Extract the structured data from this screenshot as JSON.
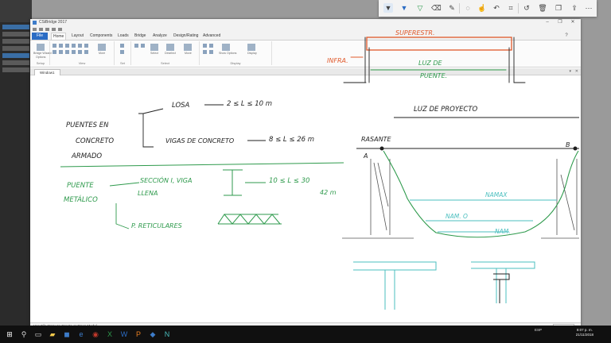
{
  "app": {
    "title": "CSiBridge 2017",
    "window_controls": {
      "minimize": "–",
      "maximize": "❐",
      "close": "✕"
    }
  },
  "ribbon": {
    "file_tab": "File",
    "tabs": [
      "Home",
      "Layout",
      "Components",
      "Loads",
      "Bridge",
      "Analyze",
      "Design/Rating",
      "Advanced"
    ],
    "active_tab": "Home",
    "groups": [
      "Setup",
      "View",
      "Select",
      "Display"
    ],
    "buttons": {
      "bridge_wizard": "Bridge Wizard",
      "options": "Options",
      "set": "Set",
      "select": "Select",
      "deselect": "Deselect",
      "move": "Move",
      "more": "More",
      "show_options": "Show Options",
      "display": "Display"
    }
  },
  "document": {
    "tab_label": "Window1",
    "controls": {
      "pin": "▾",
      "close": "✕"
    }
  },
  "statusbar": {
    "text": "Use File Menu to Create or Open Model",
    "units": "Kgf, m, C"
  },
  "sketch": {
    "top_labels": {
      "superstructure": "SUPERESTR.",
      "infra": "INFRA.",
      "span_line1": "LUZ DE",
      "span_line2": "PUENTE."
    },
    "project_span": "LUZ DE PROYECTO",
    "concrete_title": [
      "PUENTES EN",
      "CONCRETO",
      "ARMADO"
    ],
    "slab_label": "LOSA",
    "slab_range": "2 ≤ L ≤ 10 m",
    "beam_label": "VIGAS DE CONCRETO",
    "beam_range": "8 ≤ L ≤ 26 m",
    "metal_title": [
      "PUENTE",
      "METÁLICO"
    ],
    "section_label": [
      "SECCIÓN I, VIGA",
      "LLENA"
    ],
    "section_range": "10 ≤ L ≤ 30",
    "section_extra": "42 m",
    "truss_label": "P. RETICULARES",
    "abutment_left": "A",
    "abutment_right": "B",
    "deck_label": "RASANTE",
    "water_max": "NAMAX",
    "water_ord": "NAM. O",
    "water_min": "NAM."
  },
  "ink_toolbar": {
    "tools": [
      "ballpoint-pen",
      "pen-blue",
      "highlighter",
      "eraser",
      "ruler",
      "lasso",
      "undo",
      "redo",
      "crop",
      "history",
      "delete",
      "copy",
      "share",
      "more"
    ]
  },
  "taskbar": {
    "tray": [
      "ESP"
    ],
    "time": "8:07 p. m.",
    "date": "21/11/2018"
  },
  "colors": {
    "accent": "#2b6cc4",
    "ink_orange": "#e0582a",
    "ink_green": "#2e9a4c",
    "ink_teal": "#4bbfbf",
    "ink_black": "#1f1f1f"
  }
}
